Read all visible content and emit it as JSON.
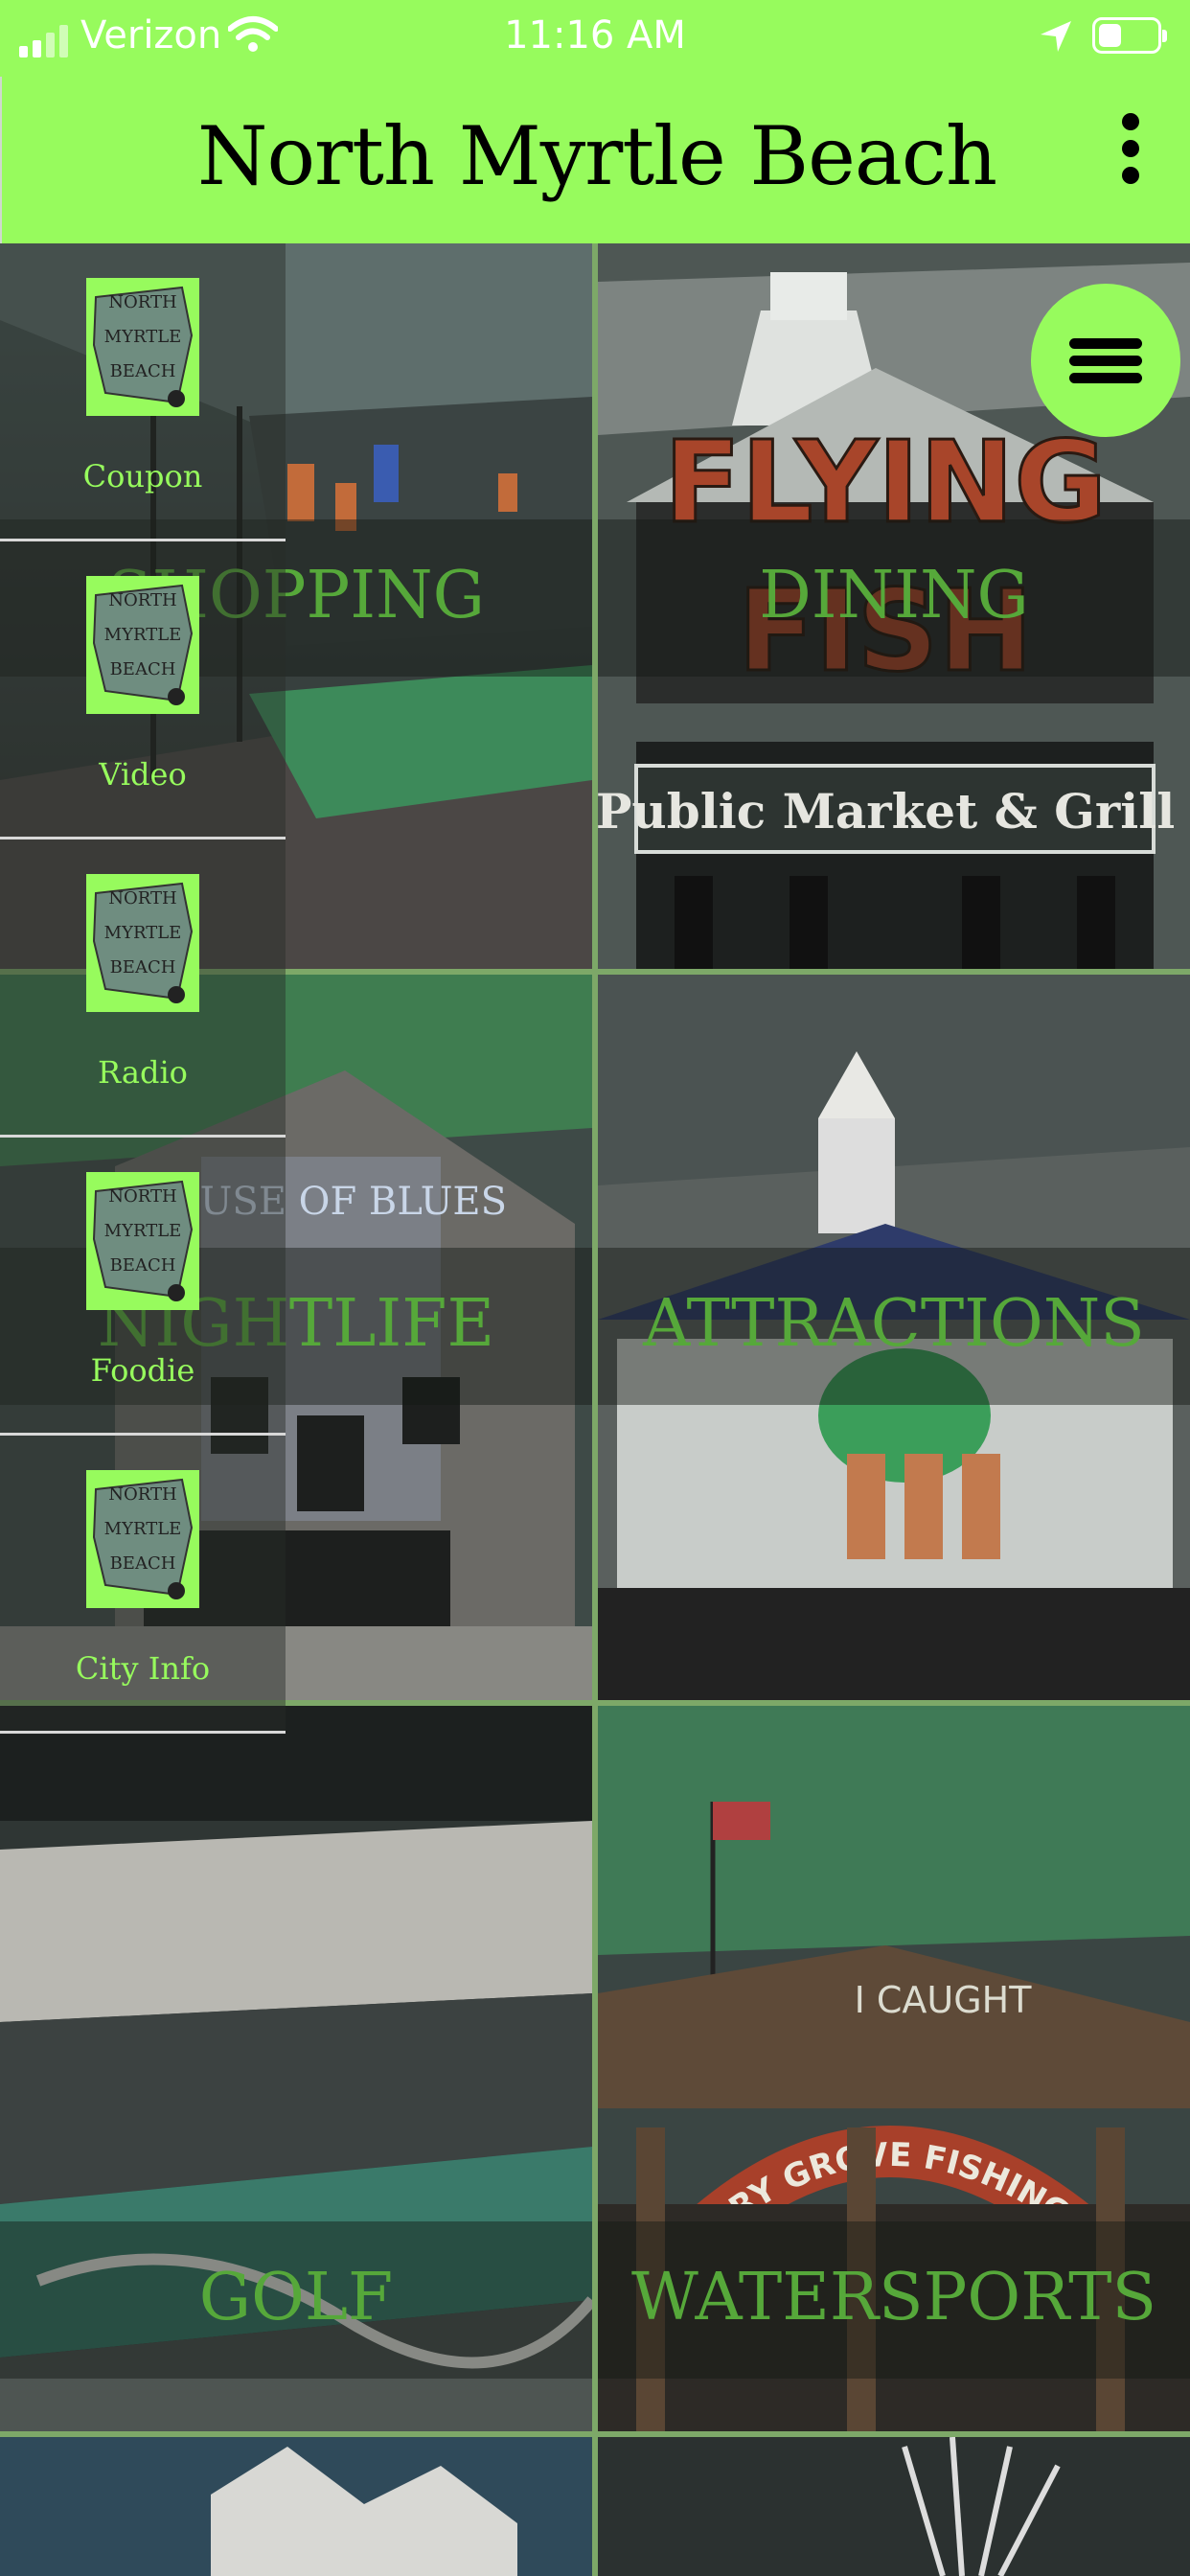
{
  "status_bar": {
    "carrier": "Verizon",
    "time": "11:16 AM",
    "battery_level": 0.4,
    "icons": [
      "signal-icon",
      "wifi-icon",
      "location-arrow-icon",
      "battery-icon"
    ]
  },
  "app_bar": {
    "title": "North Myrtle Beach",
    "menu_icon": "kebab-menu-icon"
  },
  "tiles": [
    {
      "label": "SHOPPING"
    },
    {
      "label": "DINING"
    },
    {
      "label": "NIGHTLIFE"
    },
    {
      "label": "ATTRACTIONS"
    },
    {
      "label": "GOLF"
    },
    {
      "label": "WATERSPORTS"
    }
  ],
  "tile_scene_text": {
    "dining_sign_1": "FLYING",
    "dining_sign_2": "FISH",
    "dining_sign_3": "Public Market & Grill",
    "nightlife_sign": "HOUSE OF BLUES",
    "watersports_sign_1": "I CAUGHT",
    "watersports_sign_2": "CHERRY GROVE FISHING PIER"
  },
  "drawer": {
    "logo_text": [
      "NORTH",
      "MYRTLE",
      "BEACH"
    ],
    "items": [
      {
        "label": "Coupon"
      },
      {
        "label": "Video"
      },
      {
        "label": "Radio"
      },
      {
        "label": "Foodie"
      },
      {
        "label": "City Info"
      }
    ]
  },
  "fab": {
    "icon": "hamburger-menu-icon"
  },
  "colors": {
    "accent": "#97fb5d",
    "label_green": "#56a83a",
    "grid_line": "#7da868"
  }
}
